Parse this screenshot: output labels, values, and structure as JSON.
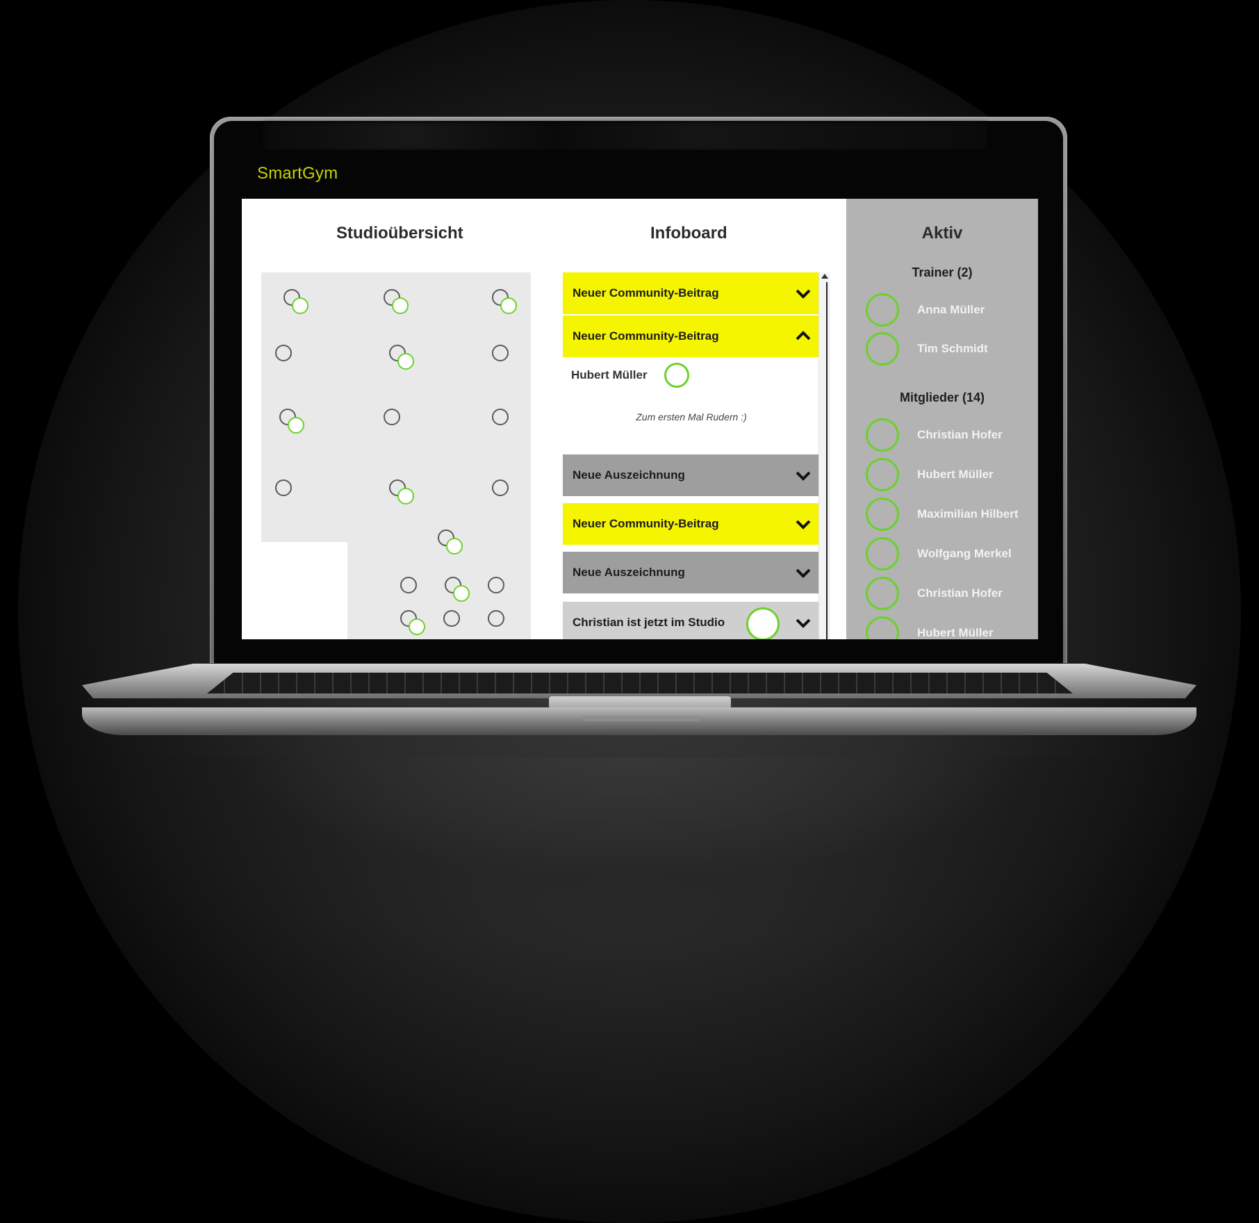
{
  "app": {
    "brand": "SmartGym"
  },
  "colors": {
    "accent": "#c8d400",
    "highlight_yellow": "#f5f500",
    "status_green": "#6cd12a",
    "panel_gray": "#b3b3b3"
  },
  "studio": {
    "title": "Studioübersicht",
    "equipment": [
      {
        "state": "active"
      },
      {
        "state": "active"
      },
      {
        "state": "active"
      },
      {
        "state": "idle"
      },
      {
        "state": "active"
      },
      {
        "state": "idle"
      },
      {
        "state": "active"
      },
      {
        "state": "idle"
      },
      {
        "state": "idle"
      },
      {
        "state": "idle"
      },
      {
        "state": "active"
      },
      {
        "state": "idle"
      },
      {
        "state": "active"
      },
      {
        "state": "idle"
      },
      {
        "state": "active"
      },
      {
        "state": "idle"
      },
      {
        "state": "active"
      },
      {
        "state": "idle"
      },
      {
        "state": "idle"
      }
    ]
  },
  "infoboard": {
    "title": "Infoboard",
    "items": [
      {
        "label": "Neuer Community-Beitrag",
        "style": "yellow",
        "expanded": false
      },
      {
        "label": "Neuer Community-Beitrag",
        "style": "yellow",
        "expanded": true
      },
      {
        "label": "Neue Auszeichnung",
        "style": "gray",
        "expanded": false
      },
      {
        "label": "Neuer Community-Beitrag",
        "style": "yellow",
        "expanded": false
      },
      {
        "label": "Neue Auszeichnung",
        "style": "gray",
        "expanded": false
      },
      {
        "label": "Christian ist jetzt im Studio",
        "style": "light",
        "expanded": false
      }
    ],
    "expanded_post": {
      "author": "Hubert Müller",
      "text": "Zum ersten Mal Rudern :)"
    }
  },
  "aktiv": {
    "title": "Aktiv",
    "trainer_heading": "Trainer (2)",
    "trainers": [
      {
        "name": "Anna Müller"
      },
      {
        "name": "Tim Schmidt"
      }
    ],
    "members_heading": "Mitglieder (14)",
    "members": [
      {
        "name": "Christian Hofer"
      },
      {
        "name": "Hubert Müller"
      },
      {
        "name": "Maximilian Hilbert"
      },
      {
        "name": "Wolfgang Merkel"
      },
      {
        "name": "Christian Hofer"
      },
      {
        "name": "Hubert Müller"
      }
    ]
  },
  "icons": {
    "chevron_collapsed": "chevron-down-icon",
    "chevron_expanded": "chevron-up-icon",
    "scroll_up": "arrow-up-icon"
  }
}
